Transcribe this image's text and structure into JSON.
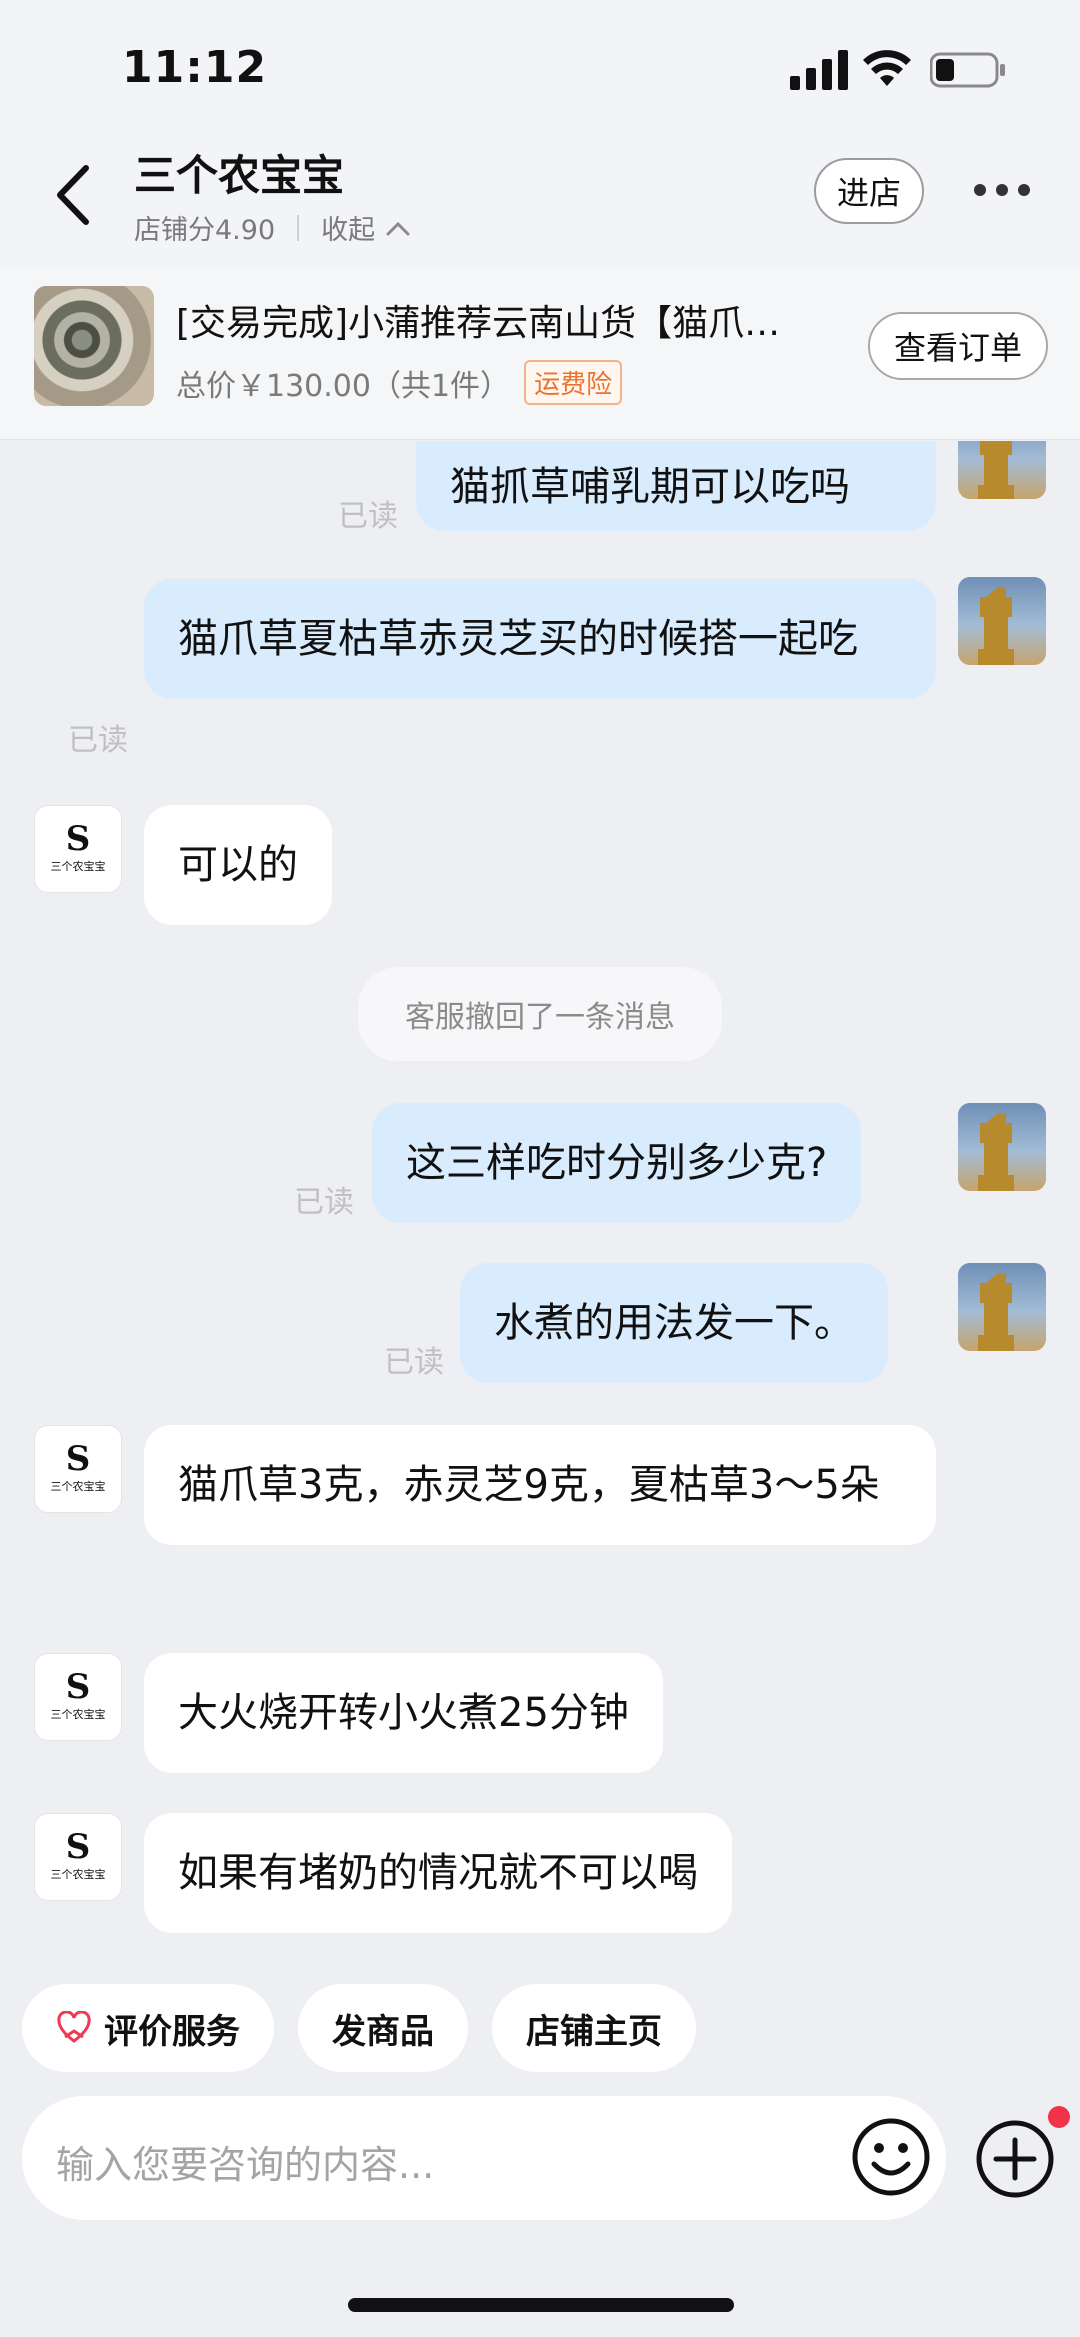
{
  "status": {
    "time": "11:12"
  },
  "header": {
    "shop_name": "三个农宝宝",
    "shop_score": "店铺分4.90",
    "collapse": "收起",
    "enter_store": "进店"
  },
  "order": {
    "title": "[交易完成]小蒲推荐云南山货【猫爪…",
    "price": "总价￥130.00（共1件）",
    "tag": "运费险",
    "view_order": "查看订单"
  },
  "chat": {
    "read_label": "已读",
    "messages": [
      {
        "from": "me",
        "text": "猫抓草哺乳期可以吃吗",
        "read": "已读"
      },
      {
        "from": "me",
        "text": "猫爪草夏枯草赤灵芝买的时候搭一起吃",
        "read": "已读"
      },
      {
        "from": "shop",
        "text": "可以的"
      },
      {
        "from": "system",
        "text": "客服撤回了一条消息"
      },
      {
        "from": "me",
        "text": "这三样吃时分别多少克?",
        "read": "已读"
      },
      {
        "from": "me",
        "text": "水煮的用法发一下。",
        "read": "已读"
      },
      {
        "from": "shop",
        "text": "猫爪草3克，赤灵芝9克，夏枯草3～5朵"
      },
      {
        "from": "shop",
        "text": "大火烧开转小火煮25分钟"
      },
      {
        "from": "shop",
        "text": "如果有堵奶的情况就不可以喝"
      }
    ],
    "shop_avatar_mark": "S",
    "shop_avatar_name": "三个农宝宝"
  },
  "quick_actions": [
    "评价服务",
    "发商品",
    "店铺主页"
  ],
  "input": {
    "placeholder": "输入您要咨询的内容..."
  },
  "colors": {
    "my_bubble": "#d9ecfd",
    "their_bubble": "#ffffff",
    "tag_orange": "#e8742f",
    "badge_red": "#f1334a"
  }
}
